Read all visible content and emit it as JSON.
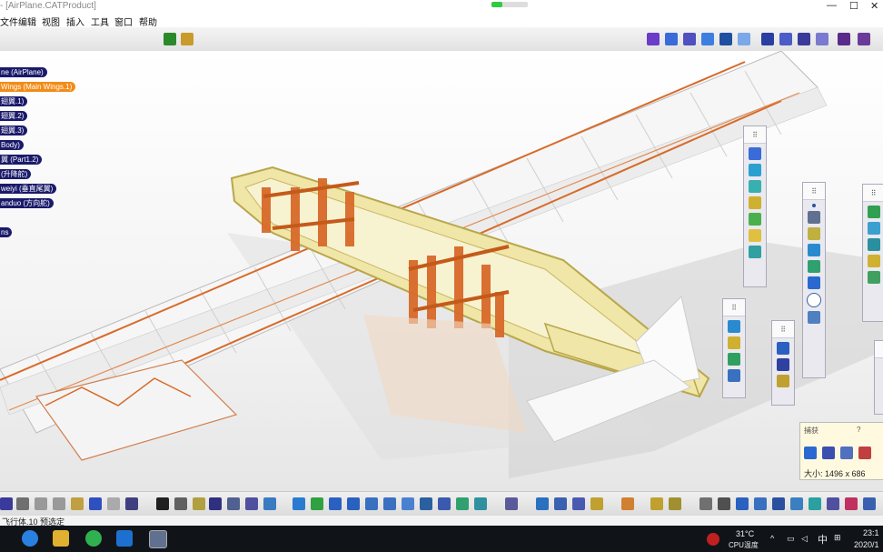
{
  "window": {
    "title": "- [AirPlane.CATProduct]"
  },
  "menu": [
    "文件",
    "编辑",
    "视图",
    "插入",
    "工具",
    "窗口",
    "帮助"
  ],
  "tree": [
    {
      "label": "ne (AirPlane)",
      "selected": false
    },
    {
      "label": "Wings (Main Wings.1)",
      "selected": true
    },
    {
      "label": "翅翼.1)",
      "selected": false
    },
    {
      "label": "翅翼.2)",
      "selected": false
    },
    {
      "label": "翅翼.3)",
      "selected": false
    },
    {
      "label": "Body)",
      "selected": false
    },
    {
      "label": "翼 (Part1.2)",
      "selected": false
    },
    {
      "label": "(升降舵)",
      "selected": false
    },
    {
      "label": "weiyi (垂直尾翼)",
      "selected": false
    },
    {
      "label": "anduo (方向舵)",
      "selected": false
    },
    {
      "label": "ns",
      "selected": false
    }
  ],
  "size_dialog": {
    "title": "捕获",
    "help": "?",
    "size_label": "大小: 1496 x 686"
  },
  "status": {
    "text": "飞行体.10 预选定"
  },
  "taskbar": {
    "weather": "31°C",
    "weather_sub": "CPU温度",
    "ime": "中",
    "time": "23:1",
    "date": "2020/1"
  },
  "colors": {
    "tree_node": "#1a1a6b",
    "tree_selected": "#f28c18",
    "wood": "#e8dc8a",
    "rib": "#d86a2a",
    "taskbar": "#101418"
  }
}
